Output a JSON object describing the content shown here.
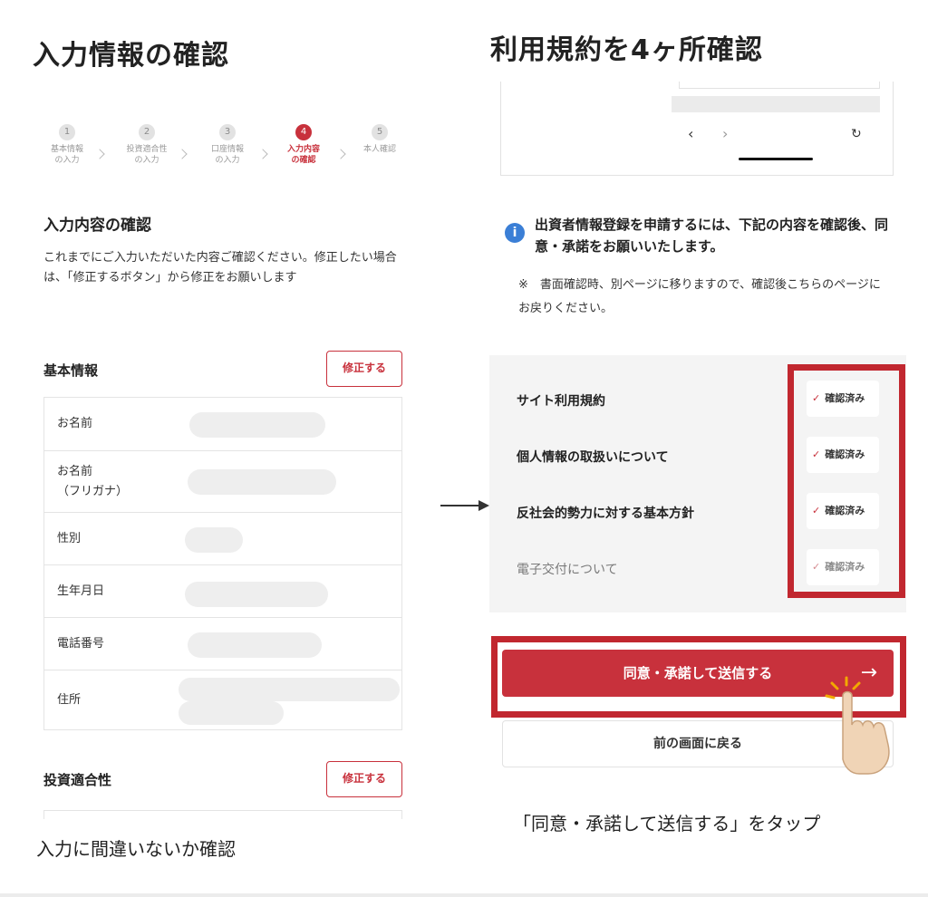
{
  "left": {
    "heading": "入力情報の確認",
    "steps": [
      {
        "num": "1",
        "label": "基本情報\nの入力"
      },
      {
        "num": "2",
        "label": "投資適合性\nの入力"
      },
      {
        "num": "3",
        "label": "口座情報\nの入力"
      },
      {
        "num": "4",
        "label": "入力内容\nの確認",
        "active": true
      },
      {
        "num": "5",
        "label": "本人確認"
      }
    ],
    "section_title": "入力内容の確認",
    "description": "これまでにご入力いただいた内容ご確認ください。修正したい場合は、「修正するボタン」から修正をお願いします",
    "basic_info": {
      "title": "基本情報",
      "edit_label": "修正する",
      "rows": [
        "お名前",
        "お名前\n（フリガナ）",
        "性別",
        "生年月日",
        "電話番号",
        "住所"
      ]
    },
    "suitability": {
      "title": "投資適合性",
      "edit_label": "修正する"
    },
    "caption": "入力に間違いないか確認"
  },
  "right": {
    "heading": "利用規約を4ヶ所確認",
    "nav_icons": [
      "back-arrow-icon",
      "forward-arrow-icon",
      "reload-icon"
    ],
    "nav_back": "‹",
    "nav_forward": "›",
    "nav_reload": "↻",
    "notice_icon": "i",
    "notice": "出資者情報登録を申請するには、下記の内容を確認後、同意・承諾をお願いいたします。",
    "note": "※　書面確認時、別ページに移りますので、確認後こちらのページにお戻りください。",
    "check_mark": "✓",
    "terms": [
      {
        "label": "サイト利用規約",
        "status": "確認済み"
      },
      {
        "label": "個人情報の取扱いについて",
        "status": "確認済み"
      },
      {
        "label": "反社会的勢力に対する基本方針",
        "status": "確認済み"
      },
      {
        "label": "電子交付について",
        "status": "確認済み"
      }
    ],
    "agree_label": "同意・承諾して送信する",
    "agree_arrow": "→",
    "back_label": "前の画面に戻る",
    "caption": "「同意・承諾して送信する」をタップ"
  },
  "colors": {
    "accent": "#c8313c",
    "highlight": "#c1272f",
    "info": "#3b7fd6"
  }
}
